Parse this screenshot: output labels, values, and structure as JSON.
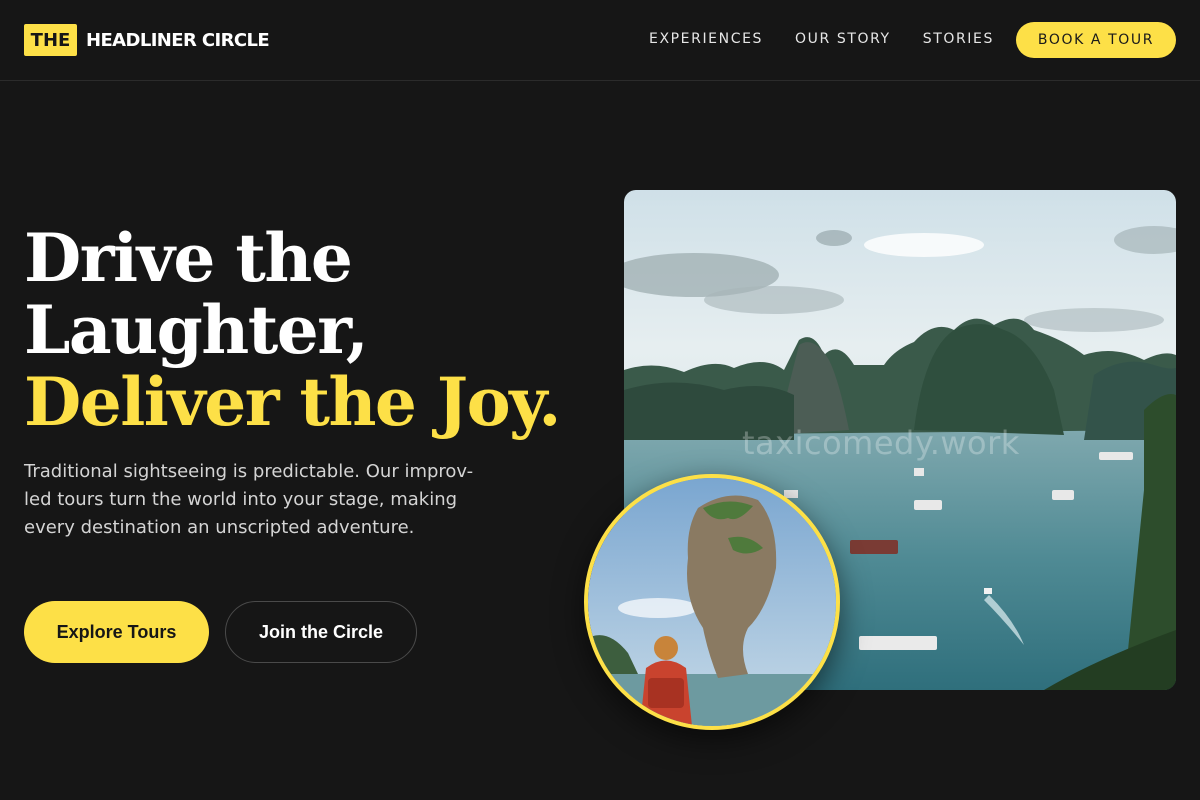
{
  "brand": {
    "mark": "THE",
    "name": "HEADLINER CIRCLE",
    "accent_color": "#fde047",
    "background_color": "#161616"
  },
  "nav": {
    "items": [
      {
        "label": "EXPERIENCES"
      },
      {
        "label": "OUR STORY"
      },
      {
        "label": "STORIES"
      }
    ],
    "cta_label": "BOOK A TOUR"
  },
  "hero": {
    "title_line1": "Drive the",
    "title_line2": "Laughter,",
    "title_accent": "Deliver the Joy.",
    "description": "Traditional sightseeing is predictable. Our improv-led tours turn the world into your stage, making every destination an unscripted adventure.",
    "primary_button": "Explore Tours",
    "secondary_button": "Join the Circle"
  },
  "images": {
    "main_watermark": "taxicomedy.work",
    "main_photo_icon": "bay-landscape-photo",
    "circle_photo_icon": "rock-pillar-traveler-photo"
  }
}
